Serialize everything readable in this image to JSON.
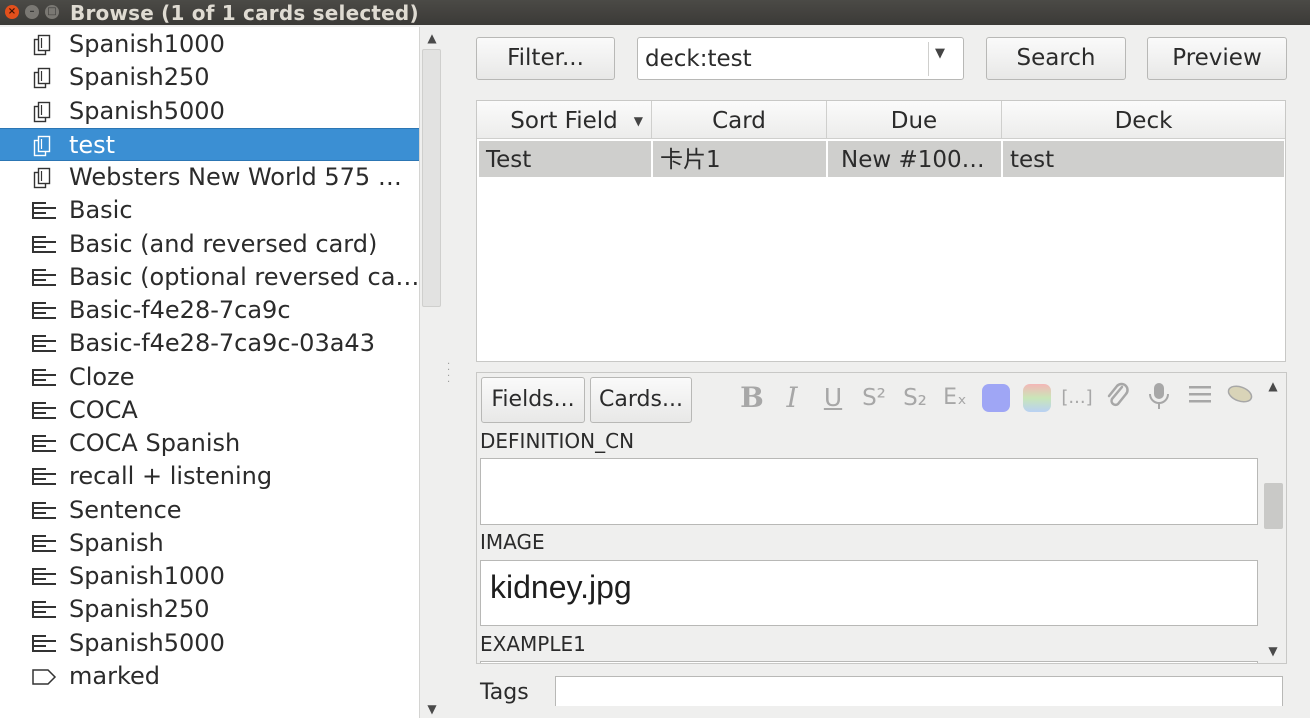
{
  "window": {
    "title": "Browse (1 of 1 cards selected)",
    "close_glyph": "×",
    "min_glyph": "–",
    "max_glyph": "□"
  },
  "sidebar": {
    "items": [
      {
        "label": "Spanish1000",
        "icon": "deck-icon"
      },
      {
        "label": "Spanish250",
        "icon": "deck-icon"
      },
      {
        "label": "Spanish5000",
        "icon": "deck-icon"
      },
      {
        "label": "test",
        "icon": "deck-icon",
        "selected": true
      },
      {
        "label": "Websters New World 575 …",
        "icon": "deck-icon"
      },
      {
        "label": "Basic",
        "icon": "note-type-icon"
      },
      {
        "label": "Basic (and reversed card)",
        "icon": "note-type-icon"
      },
      {
        "label": "Basic (optional reversed ca…",
        "icon": "note-type-icon"
      },
      {
        "label": "Basic-f4e28-7ca9c",
        "icon": "note-type-icon"
      },
      {
        "label": "Basic-f4e28-7ca9c-03a43",
        "icon": "note-type-icon"
      },
      {
        "label": "Cloze",
        "icon": "note-type-icon"
      },
      {
        "label": "COCA",
        "icon": "note-type-icon"
      },
      {
        "label": "COCA Spanish",
        "icon": "note-type-icon"
      },
      {
        "label": "recall + listening",
        "icon": "note-type-icon"
      },
      {
        "label": "Sentence",
        "icon": "note-type-icon"
      },
      {
        "label": "Spanish",
        "icon": "note-type-icon"
      },
      {
        "label": "Spanish1000",
        "icon": "note-type-icon"
      },
      {
        "label": "Spanish250",
        "icon": "note-type-icon"
      },
      {
        "label": "Spanish5000",
        "icon": "note-type-icon"
      },
      {
        "label": "marked",
        "icon": "tag-icon"
      }
    ]
  },
  "toolbar": {
    "filter_label": "Filter...",
    "search_value": "deck:test",
    "search_label": "Search",
    "preview_label": "Preview"
  },
  "table": {
    "columns": [
      "Sort Field",
      "Card",
      "Due",
      "Deck"
    ],
    "rows": [
      [
        "Test",
        "卡片1",
        "New #100…",
        "test"
      ]
    ]
  },
  "editor": {
    "fields_button": "Fields...",
    "cards_button": "Cards...",
    "format_buttons": [
      "B",
      "I",
      "U",
      "S²",
      "S₂",
      "Eₓ",
      "[...]"
    ],
    "fields": [
      {
        "name": "DEFINITION_CN",
        "value": ""
      },
      {
        "name": "IMAGE",
        "value": "kidney.jpg"
      },
      {
        "name": "EXAMPLE1",
        "value": ""
      }
    ],
    "fore_color": "#9fa6f5",
    "tags_label": "Tags",
    "tags_value": ""
  },
  "colors": {
    "selection": "#3b8fd3",
    "titlebar": "#3b3a37",
    "close_button": "#e3501c"
  }
}
